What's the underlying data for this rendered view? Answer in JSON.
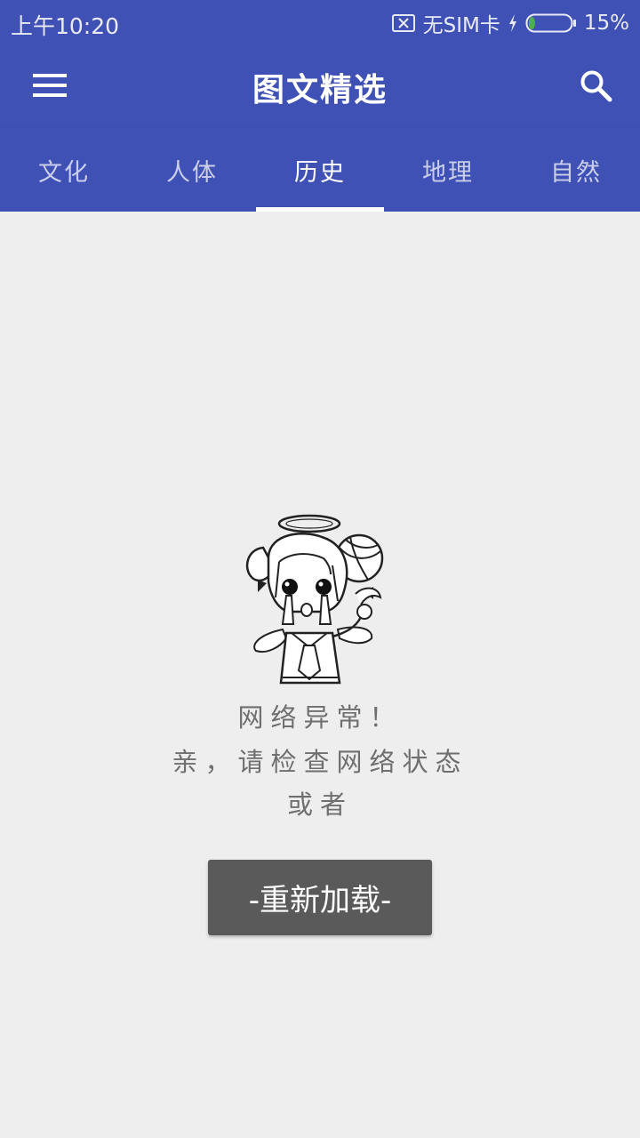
{
  "status_bar": {
    "time": "上午10:20",
    "sim_text": "无SIM卡",
    "battery_percent_text": "15%",
    "battery_level": 0.15
  },
  "toolbar": {
    "title": "图文精选",
    "menu_icon": "hamburger-menu-icon",
    "search_icon": "search-icon"
  },
  "tabs": [
    {
      "label": "文化",
      "active": false
    },
    {
      "label": "人体",
      "active": false
    },
    {
      "label": "历史",
      "active": true
    },
    {
      "label": "地理",
      "active": false
    },
    {
      "label": "自然",
      "active": false
    }
  ],
  "error": {
    "line1": "网络异常！",
    "line2": "亲，请检查网络状态",
    "line3": "或者"
  },
  "reload_button": {
    "label": "-重新加载-"
  },
  "colors": {
    "primary": "#3f51b5",
    "background": "#eeeeee",
    "button": "#5a5a5a",
    "battery_green": "#4caf50"
  }
}
